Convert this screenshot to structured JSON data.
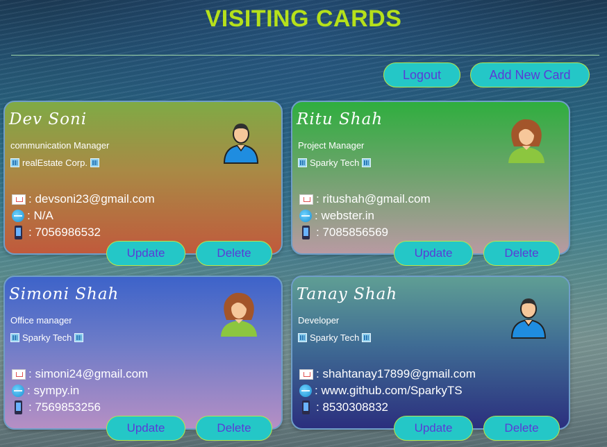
{
  "header": {
    "title": "VISITING CARDS"
  },
  "toolbar": {
    "logout_label": "Logout",
    "add_label": "Add New Card"
  },
  "cards": [
    {
      "name": "Dev Soni",
      "role": "communication Manager",
      "company": "realEstate Corp.",
      "email": ": devsoni23@gmail.com",
      "website": ": N/A",
      "phone": ": 7056986532",
      "avatar": "male-avatar-icon",
      "update_label": "Update",
      "delete_label": "Delete"
    },
    {
      "name": "Ritu Shah",
      "role": "Project Manager",
      "company": "Sparky Tech",
      "email": ": ritushah@gmail.com",
      "website": ": webster.in",
      "phone": ": 7085856569",
      "avatar": "female-avatar-icon",
      "update_label": "Update",
      "delete_label": "Delete"
    },
    {
      "name": "Simoni Shah",
      "role": "Office manager",
      "company": "Sparky Tech",
      "email": ": simoni24@gmail.com",
      "website": ": sympy.in",
      "phone": ": 7569853256",
      "avatar": "female-avatar-icon",
      "update_label": "Update",
      "delete_label": "Delete"
    },
    {
      "name": "Tanay Shah",
      "role": "Developer",
      "company": "Sparky Tech",
      "email": ": shahtanay17899@gmail.com",
      "website": ": www.github.com/SparkyTS",
      "phone": ": 8530308832",
      "avatar": "male-avatar-icon",
      "update_label": "Update",
      "delete_label": "Delete"
    }
  ],
  "colors": {
    "title": "#b6e11b",
    "button_bg": "#24c7c7",
    "button_text": "#5a3bd6",
    "button_border": "#b8e64a"
  }
}
